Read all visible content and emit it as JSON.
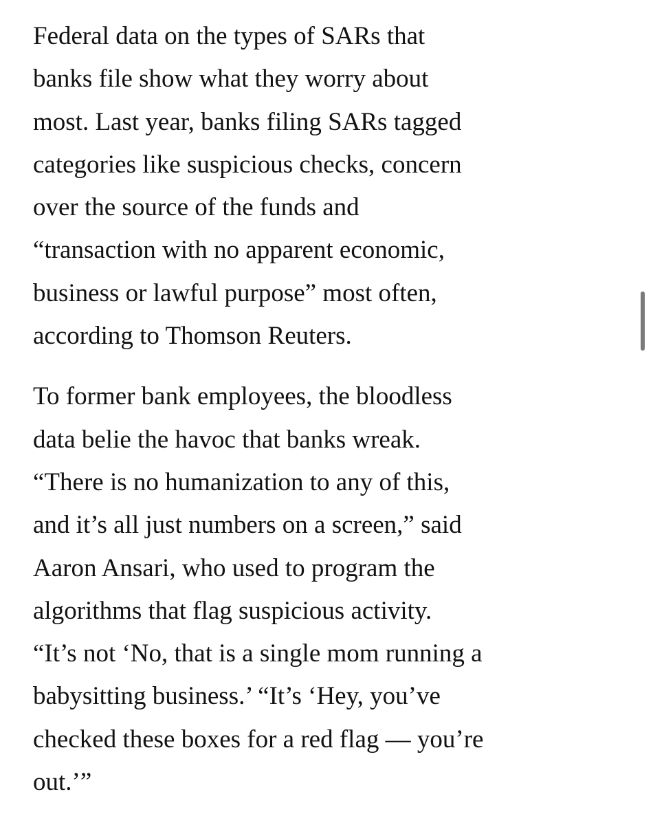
{
  "article": {
    "paragraphs": [
      {
        "lines": [
          "Federal data on the types of SARs that",
          "banks file show what they worry about",
          "most. Last year, banks filing SARs tagged",
          "categories like suspicious checks, concern",
          "over the source of the funds and",
          "“transaction with no apparent economic,",
          "business or lawful purpose” most often,",
          "according to Thomson Reuters."
        ]
      },
      {
        "lines": [
          "To former bank employees, the bloodless",
          "data belie the havoc that banks wreak.",
          "“There is no humanization to any of this,",
          "and it’s all just numbers on a screen,” said",
          "Aaron Ansari, who used to program the",
          "algorithms that flag suspicious activity.",
          "“It’s not ‘No, that is a single mom running a",
          "babysitting business.’ “It’s ‘Hey, you’ve",
          "checked these boxes for a red flag — you’re",
          "out.’”"
        ]
      }
    ]
  }
}
